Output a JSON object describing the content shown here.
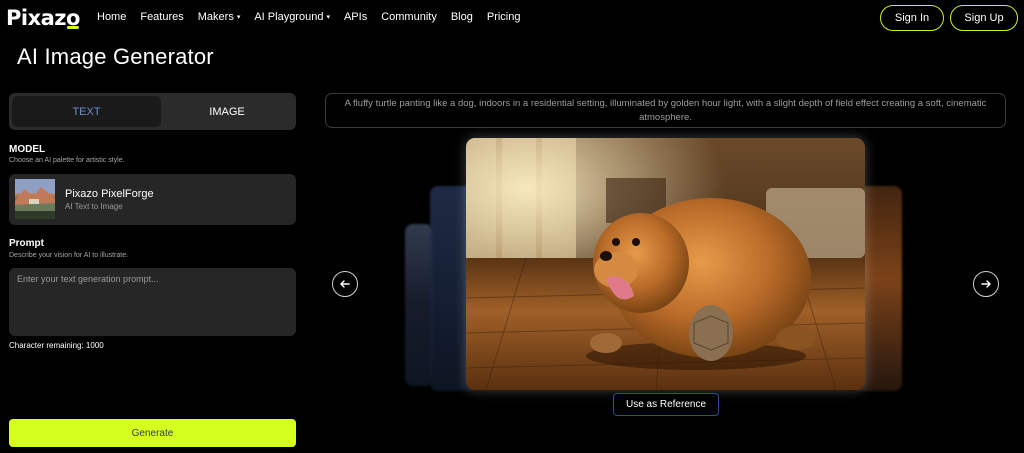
{
  "brand": {
    "name_part1": "Pixaz",
    "name_part2": "o",
    "accent": "#d4ff1f"
  },
  "nav": {
    "links": [
      "Home",
      "Features",
      "Makers",
      "AI Playground",
      "APIs",
      "Community",
      "Blog",
      "Pricing"
    ],
    "dropdown_caret": "▾",
    "sign_in": "Sign In",
    "sign_up": "Sign Up"
  },
  "page": {
    "title": "AI Image Generator"
  },
  "tabs": {
    "text": "TEXT",
    "image": "IMAGE",
    "active": "TEXT"
  },
  "model": {
    "label": "MODEL",
    "subtitle": "Choose an AI palette for artistic style.",
    "name": "Pixazo PixelForge",
    "type": "AI Text to Image"
  },
  "prompt": {
    "label": "Prompt",
    "subtitle": "Describe your vision for AI to illustrate.",
    "placeholder": "Enter your text generation prompt...",
    "value": "",
    "char_remaining_label": "Character remaining: 1000"
  },
  "generate_label": "Generate",
  "gallery": {
    "prompt_text": "A fluffy turtle panting like a dog, indoors in a residential setting, illuminated by golden hour light, with a slight depth of field effect creating a soft, cinematic atmosphere.",
    "reference_button": "Use as Reference",
    "prev_icon": "arrow-left-icon",
    "next_icon": "arrow-right-icon"
  }
}
